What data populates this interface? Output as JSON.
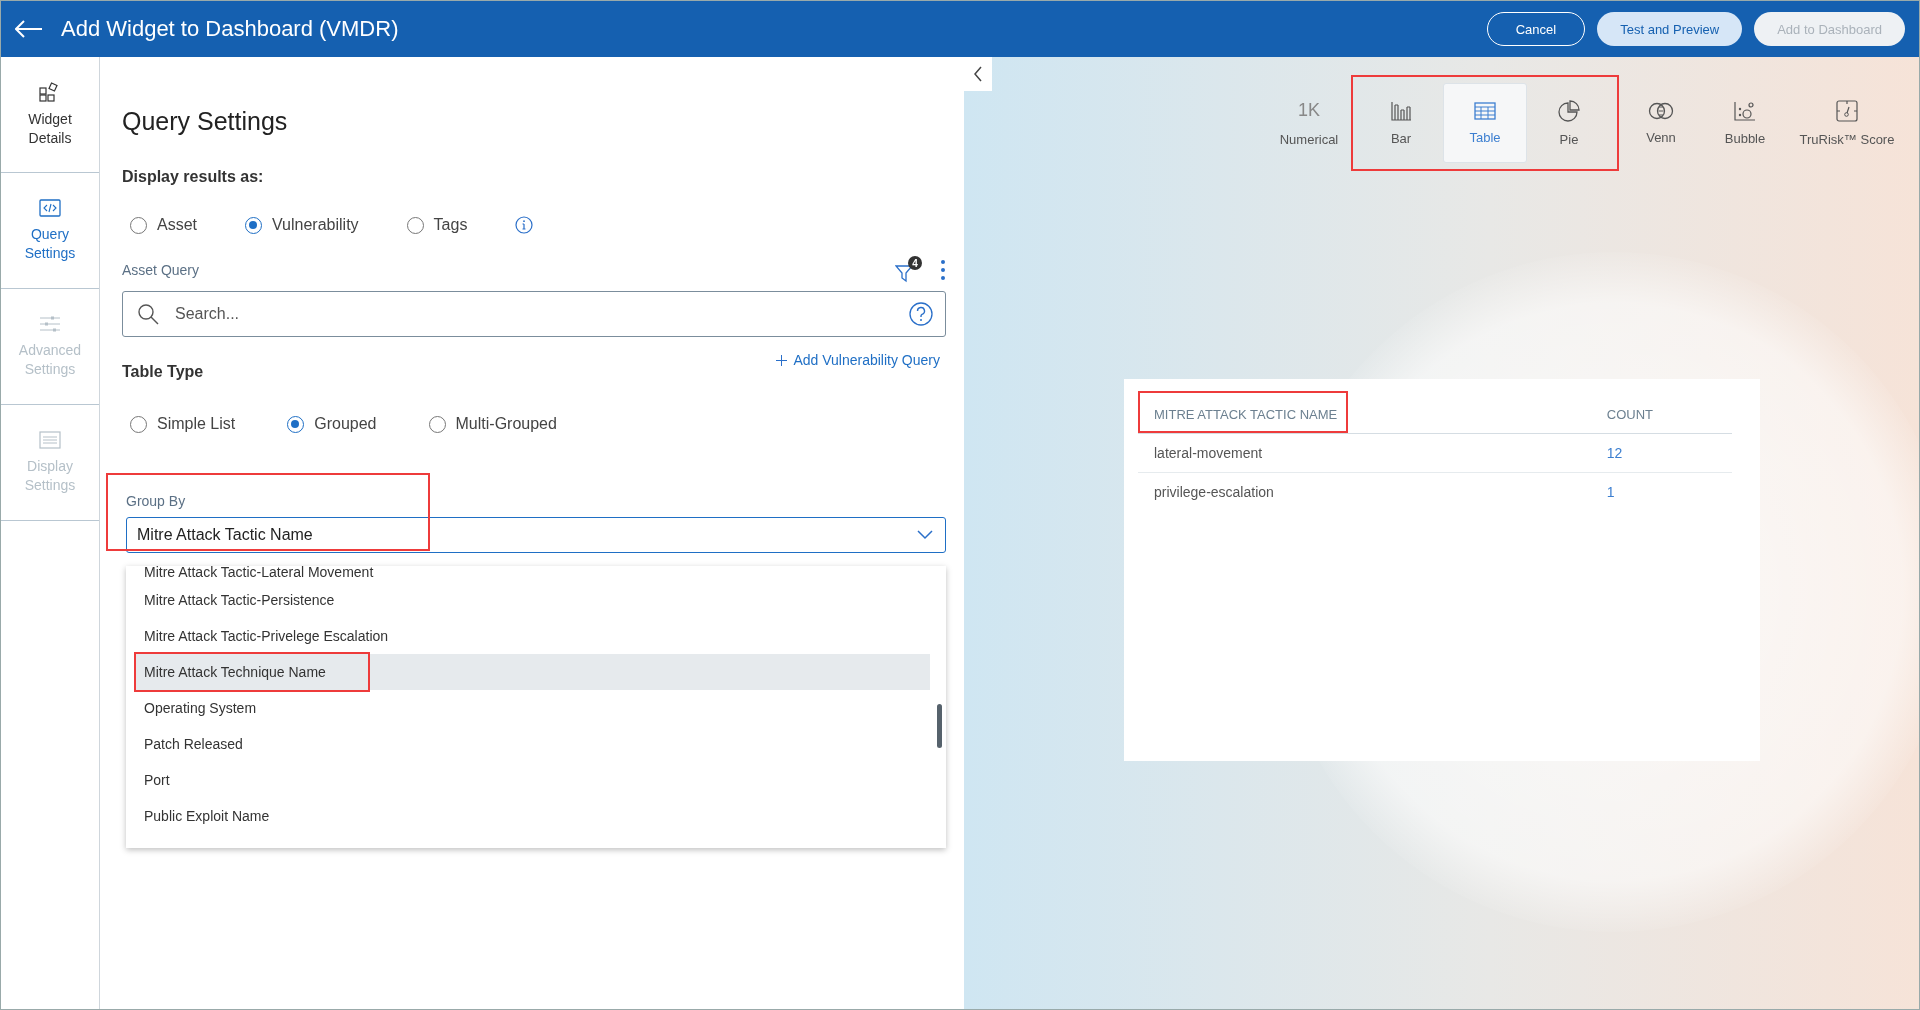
{
  "header": {
    "title": "Add Widget to Dashboard (VMDR)",
    "buttons": [
      {
        "label": "Cancel",
        "kind": "outline"
      },
      {
        "label": "Test and Preview",
        "kind": "light"
      },
      {
        "label": "Add to Dashboard",
        "kind": "disabled"
      }
    ]
  },
  "sidebar": {
    "items": [
      {
        "label": "Widget Details",
        "kind": "widgets",
        "selected": false,
        "disabled": false
      },
      {
        "label": "Query Settings",
        "kind": "code",
        "selected": true,
        "disabled": false
      },
      {
        "label": "Advanced Settings",
        "kind": "sliders",
        "selected": false,
        "disabled": true
      },
      {
        "label": "Display Settings",
        "kind": "display",
        "selected": false,
        "disabled": true
      }
    ]
  },
  "query_settings": {
    "title": "Query Settings",
    "display_label": "Display results as:",
    "display_options": [
      {
        "label": "Asset",
        "selected": false
      },
      {
        "label": "Vulnerability",
        "selected": true
      },
      {
        "label": "Tags",
        "selected": false
      }
    ],
    "asset_query_label": "Asset Query",
    "filter_count": "4",
    "search_placeholder": "Search...",
    "add_query": "Add Vulnerability Query",
    "table_type_label": "Table Type",
    "table_types": [
      {
        "label": "Simple List",
        "selected": false
      },
      {
        "label": "Grouped",
        "selected": true
      },
      {
        "label": "Multi-Grouped",
        "selected": false
      }
    ],
    "group_by": {
      "label": "Group By",
      "value": "Mitre Attack Tactic Name",
      "annotated": true,
      "options": [
        {
          "label": "Mitre Attack Tactic-Lateral Movement",
          "highlighted": false,
          "annotated": false
        },
        {
          "label": "Mitre Attack Tactic-Persistence",
          "highlighted": false,
          "annotated": false
        },
        {
          "label": "Mitre Attack Tactic-Privelege Escalation",
          "highlighted": false,
          "annotated": false
        },
        {
          "label": "Mitre Attack Technique Name",
          "highlighted": true,
          "annotated": true
        },
        {
          "label": "Operating System",
          "highlighted": false,
          "annotated": false
        },
        {
          "label": "Patch Released",
          "highlighted": false,
          "annotated": false
        },
        {
          "label": "Port",
          "highlighted": false,
          "annotated": false
        },
        {
          "label": "Public Exploit Name",
          "highlighted": false,
          "annotated": false
        }
      ]
    }
  },
  "preview": {
    "chart_types": [
      {
        "label": "Numerical",
        "kind": "numerical",
        "icon_text": "1K",
        "selected": false,
        "annotated": false
      },
      {
        "label": "Bar",
        "kind": "bar",
        "selected": false,
        "annotated": true
      },
      {
        "label": "Table",
        "kind": "table",
        "selected": true,
        "annotated": true
      },
      {
        "label": "Pie",
        "kind": "pie",
        "selected": false,
        "annotated": true
      },
      {
        "label": "Venn",
        "kind": "venn",
        "selected": false,
        "annotated": false
      },
      {
        "label": "Bubble",
        "kind": "bubble",
        "selected": false,
        "annotated": false
      },
      {
        "label": "TruRisk™ Score",
        "kind": "score",
        "selected": false,
        "annotated": false
      }
    ],
    "table": {
      "columns": [
        {
          "label": "MITRE ATTACK TACTIC NAME",
          "annotated": true
        },
        {
          "label": "COUNT",
          "annotated": false
        }
      ],
      "rows": [
        [
          "lateral-movement",
          "12"
        ],
        [
          "privilege-escalation",
          "1"
        ]
      ]
    }
  }
}
